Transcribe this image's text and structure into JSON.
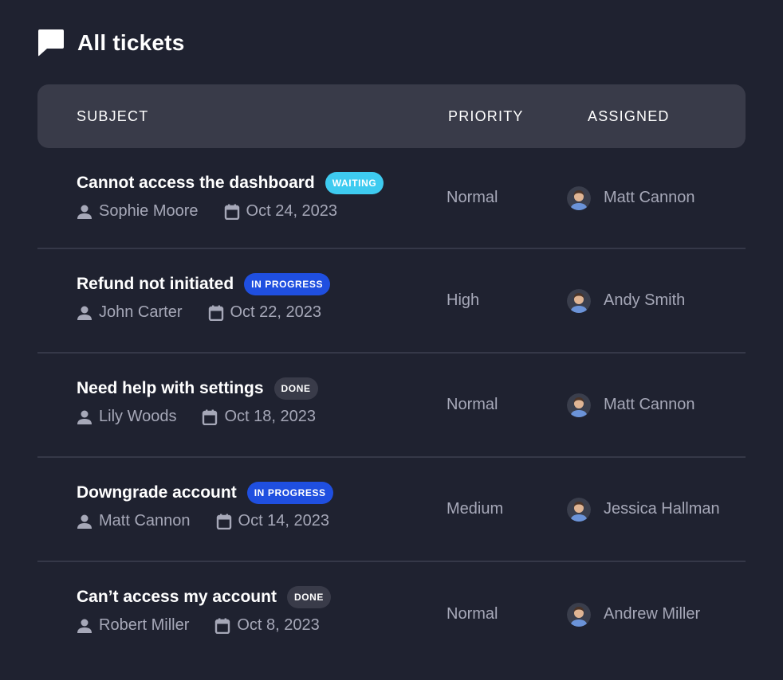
{
  "page": {
    "title": "All tickets",
    "title_icon": "chat-bubble-icon"
  },
  "table": {
    "headers": {
      "subject": "SUBJECT",
      "priority": "PRIORITY",
      "assigned": "ASSIGNED"
    },
    "rows": [
      {
        "subject": "Cannot access the dashboard",
        "status": "WAITING",
        "status_bg": "#3ecbf0",
        "status_fg": "#ffffff",
        "requester": "Sophie Moore",
        "date": "Oct 24, 2023",
        "priority": "Normal",
        "assignee": "Matt Cannon"
      },
      {
        "subject": "Refund not initiated",
        "status": "IN PROGRESS",
        "status_bg": "#1f4fe0",
        "status_fg": "#ffffff",
        "requester": "John Carter",
        "date": "Oct 22, 2023",
        "priority": "High",
        "assignee": "Andy Smith"
      },
      {
        "subject": "Need help with settings",
        "status": "DONE",
        "status_bg": "#393b49",
        "status_fg": "#ffffff",
        "requester": "Lily Woods",
        "date": "Oct 18, 2023",
        "priority": "Normal",
        "assignee": "Matt Cannon"
      },
      {
        "subject": "Downgrade account",
        "status": "IN PROGRESS",
        "status_bg": "#1f4fe0",
        "status_fg": "#ffffff",
        "requester": "Matt Cannon",
        "date": "Oct 14, 2023",
        "priority": "Medium",
        "assignee": "Jessica Hallman"
      },
      {
        "subject": "Can’t access my account",
        "status": "DONE",
        "status_bg": "#393b49",
        "status_fg": "#ffffff",
        "requester": "Robert Miller",
        "date": "Oct 8, 2023",
        "priority": "Normal",
        "assignee": "Andrew Miller"
      }
    ]
  },
  "colors": {
    "background": "#1f2230",
    "header_bg": "#393b49",
    "muted_text": "#a6a8b8",
    "divider": "#353848"
  }
}
